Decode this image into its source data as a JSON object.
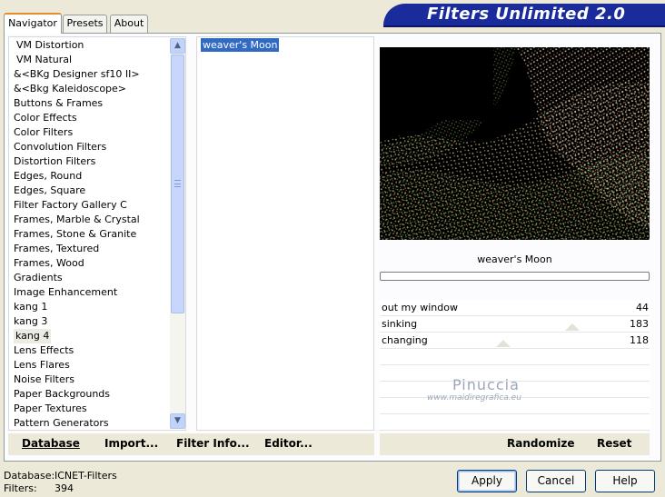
{
  "window": {
    "banner_title": "Filters Unlimited 2.0"
  },
  "tabs": [
    {
      "label": "Navigator",
      "active": true
    },
    {
      "label": "Presets",
      "active": false
    },
    {
      "label": "About",
      "active": false
    }
  ],
  "categories": [
    "VM Distortion",
    "VM Natural",
    "&<BKg Designer sf10 II>",
    "&<Bkg Kaleidoscope>",
    "Buttons & Frames",
    "Color Effects",
    "Color Filters",
    "Convolution Filters",
    "Distortion Filters",
    "Edges, Round",
    "Edges, Square",
    "Filter Factory Gallery C",
    "Frames, Marble & Crystal",
    "Frames, Stone & Granite",
    "Frames, Textured",
    "Frames, Wood",
    "Gradients",
    "Image Enhancement",
    "kang 1",
    "kang 3",
    "kang 4",
    "Lens Effects",
    "Lens Flares",
    "Noise Filters",
    "Paper Backgrounds",
    "Paper Textures",
    "Pattern Generators"
  ],
  "selected_category": "kang 4",
  "filters": [
    "weaver's Moon"
  ],
  "preview": {
    "filter_name": "weaver's Moon"
  },
  "params": [
    {
      "name": "out my window",
      "value": "44"
    },
    {
      "name": "sinking",
      "value": "183"
    },
    {
      "name": "changing",
      "value": "118"
    }
  ],
  "watermark": {
    "name": "Pinuccia",
    "url": "www.maidiregrafica.eu"
  },
  "left_bar": {
    "database": "Database",
    "import": "Import...",
    "filter_info": "Filter Info...",
    "editor": "Editor..."
  },
  "right_bar": {
    "randomize": "Randomize",
    "reset": "Reset"
  },
  "status": {
    "db_label": "Database:",
    "db_value": "ICNET-Filters",
    "filters_label": "Filters:",
    "filters_value": "394"
  },
  "buttons": {
    "apply": "Apply",
    "cancel": "Cancel",
    "help": "Help"
  },
  "colors": {
    "banner": "#1a2b9c",
    "selection": "#316ac5",
    "tab_accent": "#e68b2c"
  }
}
